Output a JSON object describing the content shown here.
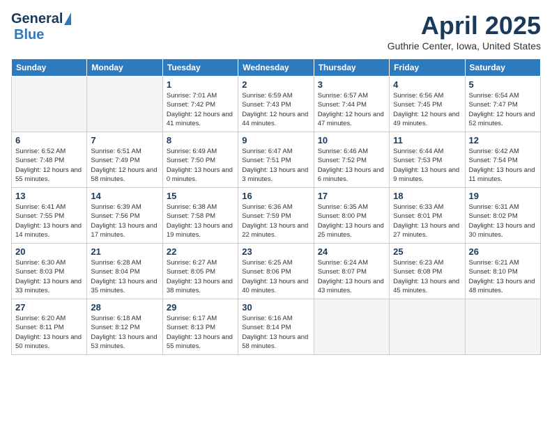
{
  "header": {
    "logo_general": "General",
    "logo_blue": "Blue",
    "month_title": "April 2025",
    "location": "Guthrie Center, Iowa, United States"
  },
  "days_of_week": [
    "Sunday",
    "Monday",
    "Tuesday",
    "Wednesday",
    "Thursday",
    "Friday",
    "Saturday"
  ],
  "weeks": [
    [
      {
        "day": "",
        "info": ""
      },
      {
        "day": "",
        "info": ""
      },
      {
        "day": "1",
        "info": "Sunrise: 7:01 AM\nSunset: 7:42 PM\nDaylight: 12 hours and 41 minutes."
      },
      {
        "day": "2",
        "info": "Sunrise: 6:59 AM\nSunset: 7:43 PM\nDaylight: 12 hours and 44 minutes."
      },
      {
        "day": "3",
        "info": "Sunrise: 6:57 AM\nSunset: 7:44 PM\nDaylight: 12 hours and 47 minutes."
      },
      {
        "day": "4",
        "info": "Sunrise: 6:56 AM\nSunset: 7:45 PM\nDaylight: 12 hours and 49 minutes."
      },
      {
        "day": "5",
        "info": "Sunrise: 6:54 AM\nSunset: 7:47 PM\nDaylight: 12 hours and 52 minutes."
      }
    ],
    [
      {
        "day": "6",
        "info": "Sunrise: 6:52 AM\nSunset: 7:48 PM\nDaylight: 12 hours and 55 minutes."
      },
      {
        "day": "7",
        "info": "Sunrise: 6:51 AM\nSunset: 7:49 PM\nDaylight: 12 hours and 58 minutes."
      },
      {
        "day": "8",
        "info": "Sunrise: 6:49 AM\nSunset: 7:50 PM\nDaylight: 13 hours and 0 minutes."
      },
      {
        "day": "9",
        "info": "Sunrise: 6:47 AM\nSunset: 7:51 PM\nDaylight: 13 hours and 3 minutes."
      },
      {
        "day": "10",
        "info": "Sunrise: 6:46 AM\nSunset: 7:52 PM\nDaylight: 13 hours and 6 minutes."
      },
      {
        "day": "11",
        "info": "Sunrise: 6:44 AM\nSunset: 7:53 PM\nDaylight: 13 hours and 9 minutes."
      },
      {
        "day": "12",
        "info": "Sunrise: 6:42 AM\nSunset: 7:54 PM\nDaylight: 13 hours and 11 minutes."
      }
    ],
    [
      {
        "day": "13",
        "info": "Sunrise: 6:41 AM\nSunset: 7:55 PM\nDaylight: 13 hours and 14 minutes."
      },
      {
        "day": "14",
        "info": "Sunrise: 6:39 AM\nSunset: 7:56 PM\nDaylight: 13 hours and 17 minutes."
      },
      {
        "day": "15",
        "info": "Sunrise: 6:38 AM\nSunset: 7:58 PM\nDaylight: 13 hours and 19 minutes."
      },
      {
        "day": "16",
        "info": "Sunrise: 6:36 AM\nSunset: 7:59 PM\nDaylight: 13 hours and 22 minutes."
      },
      {
        "day": "17",
        "info": "Sunrise: 6:35 AM\nSunset: 8:00 PM\nDaylight: 13 hours and 25 minutes."
      },
      {
        "day": "18",
        "info": "Sunrise: 6:33 AM\nSunset: 8:01 PM\nDaylight: 13 hours and 27 minutes."
      },
      {
        "day": "19",
        "info": "Sunrise: 6:31 AM\nSunset: 8:02 PM\nDaylight: 13 hours and 30 minutes."
      }
    ],
    [
      {
        "day": "20",
        "info": "Sunrise: 6:30 AM\nSunset: 8:03 PM\nDaylight: 13 hours and 33 minutes."
      },
      {
        "day": "21",
        "info": "Sunrise: 6:28 AM\nSunset: 8:04 PM\nDaylight: 13 hours and 35 minutes."
      },
      {
        "day": "22",
        "info": "Sunrise: 6:27 AM\nSunset: 8:05 PM\nDaylight: 13 hours and 38 minutes."
      },
      {
        "day": "23",
        "info": "Sunrise: 6:25 AM\nSunset: 8:06 PM\nDaylight: 13 hours and 40 minutes."
      },
      {
        "day": "24",
        "info": "Sunrise: 6:24 AM\nSunset: 8:07 PM\nDaylight: 13 hours and 43 minutes."
      },
      {
        "day": "25",
        "info": "Sunrise: 6:23 AM\nSunset: 8:08 PM\nDaylight: 13 hours and 45 minutes."
      },
      {
        "day": "26",
        "info": "Sunrise: 6:21 AM\nSunset: 8:10 PM\nDaylight: 13 hours and 48 minutes."
      }
    ],
    [
      {
        "day": "27",
        "info": "Sunrise: 6:20 AM\nSunset: 8:11 PM\nDaylight: 13 hours and 50 minutes."
      },
      {
        "day": "28",
        "info": "Sunrise: 6:18 AM\nSunset: 8:12 PM\nDaylight: 13 hours and 53 minutes."
      },
      {
        "day": "29",
        "info": "Sunrise: 6:17 AM\nSunset: 8:13 PM\nDaylight: 13 hours and 55 minutes."
      },
      {
        "day": "30",
        "info": "Sunrise: 6:16 AM\nSunset: 8:14 PM\nDaylight: 13 hours and 58 minutes."
      },
      {
        "day": "",
        "info": ""
      },
      {
        "day": "",
        "info": ""
      },
      {
        "day": "",
        "info": ""
      }
    ]
  ]
}
